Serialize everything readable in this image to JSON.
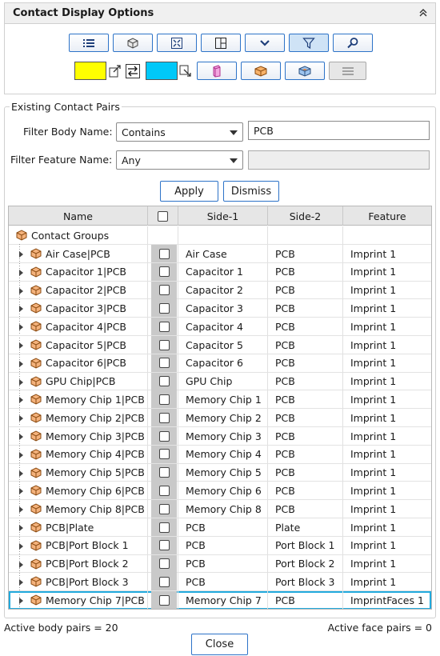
{
  "panel": {
    "title": "Contact Display Options"
  },
  "toolbar_row1": [
    {
      "name": "list-button",
      "icon": "list-icon"
    },
    {
      "name": "box-view-button",
      "icon": "box-icon"
    },
    {
      "name": "fit-view-button",
      "icon": "fit-icon"
    },
    {
      "name": "layout-button",
      "icon": "layout-icon"
    },
    {
      "name": "expand-button",
      "icon": "chevron-down-icon"
    },
    {
      "name": "filter-button",
      "icon": "filter-icon",
      "active": true
    },
    {
      "name": "search-button",
      "icon": "search-icon"
    }
  ],
  "toolbar_row2": {
    "color_1": "#ffff00",
    "color_2": "#00c8f8",
    "buttons": [
      {
        "name": "transparent-body-button",
        "icon": "pink-box-icon"
      },
      {
        "name": "orange-body-button",
        "icon": "orange-box-icon"
      },
      {
        "name": "assembly-body-button",
        "icon": "assembly-icon"
      },
      {
        "name": "menu-button",
        "icon": "menu-icon",
        "disabled": true
      }
    ]
  },
  "existing_pairs": {
    "group_title": "Existing Contact Pairs",
    "filter_body_label": "Filter Body Name:",
    "filter_body_mode": "Contains",
    "filter_body_value": "PCB",
    "filter_feature_label": "Filter Feature Name:",
    "filter_feature_mode": "Any",
    "filter_feature_value": "",
    "apply_label": "Apply",
    "dismiss_label": "Dismiss"
  },
  "table": {
    "columns": [
      "Name",
      "",
      "Side-1",
      "Side-2",
      "Feature"
    ],
    "root": "Contact Groups",
    "rows": [
      {
        "name": "Air Case|PCB",
        "side1": "Air Case",
        "side2": "PCB",
        "feature": "Imprint 1"
      },
      {
        "name": "Capacitor 1|PCB",
        "side1": "Capacitor 1",
        "side2": "PCB",
        "feature": "Imprint 1"
      },
      {
        "name": "Capacitor 2|PCB",
        "side1": "Capacitor 2",
        "side2": "PCB",
        "feature": "Imprint 1"
      },
      {
        "name": "Capacitor 3|PCB",
        "side1": "Capacitor 3",
        "side2": "PCB",
        "feature": "Imprint 1"
      },
      {
        "name": "Capacitor 4|PCB",
        "side1": "Capacitor 4",
        "side2": "PCB",
        "feature": "Imprint 1"
      },
      {
        "name": "Capacitor 5|PCB",
        "side1": "Capacitor 5",
        "side2": "PCB",
        "feature": "Imprint 1"
      },
      {
        "name": "Capacitor 6|PCB",
        "side1": "Capacitor 6",
        "side2": "PCB",
        "feature": "Imprint 1"
      },
      {
        "name": "GPU Chip|PCB",
        "side1": "GPU Chip",
        "side2": "PCB",
        "feature": "Imprint 1"
      },
      {
        "name": "Memory Chip 1|PCB",
        "side1": "Memory Chip 1",
        "side2": "PCB",
        "feature": "Imprint 1"
      },
      {
        "name": "Memory Chip 2|PCB",
        "side1": "Memory Chip 2",
        "side2": "PCB",
        "feature": "Imprint 1"
      },
      {
        "name": "Memory Chip 3|PCB",
        "side1": "Memory Chip 3",
        "side2": "PCB",
        "feature": "Imprint 1"
      },
      {
        "name": "Memory Chip 4|PCB",
        "side1": "Memory Chip 4",
        "side2": "PCB",
        "feature": "Imprint 1"
      },
      {
        "name": "Memory Chip 5|PCB",
        "side1": "Memory Chip 5",
        "side2": "PCB",
        "feature": "Imprint 1"
      },
      {
        "name": "Memory Chip 6|PCB",
        "side1": "Memory Chip 6",
        "side2": "PCB",
        "feature": "Imprint 1"
      },
      {
        "name": "Memory Chip 8|PCB",
        "side1": "Memory Chip 8",
        "side2": "PCB",
        "feature": "Imprint 1"
      },
      {
        "name": "PCB|Plate",
        "side1": "PCB",
        "side2": "Plate",
        "feature": "Imprint 1"
      },
      {
        "name": "PCB|Port Block 1",
        "side1": "PCB",
        "side2": "Port Block 1",
        "feature": "Imprint 1"
      },
      {
        "name": "PCB|Port Block 2",
        "side1": "PCB",
        "side2": "Port Block 2",
        "feature": "Imprint 1"
      },
      {
        "name": "PCB|Port Block 3",
        "side1": "PCB",
        "side2": "Port Block 3",
        "feature": "Imprint 1"
      },
      {
        "name": "Memory Chip 7|PCB",
        "side1": "Memory Chip 7",
        "side2": "PCB",
        "feature": "ImprintFaces 1",
        "selected": true
      }
    ]
  },
  "footer": {
    "active_body_pairs": "Active body pairs  = 20",
    "active_face_pairs": "Active face pairs  = 0",
    "close_label": "Close"
  }
}
